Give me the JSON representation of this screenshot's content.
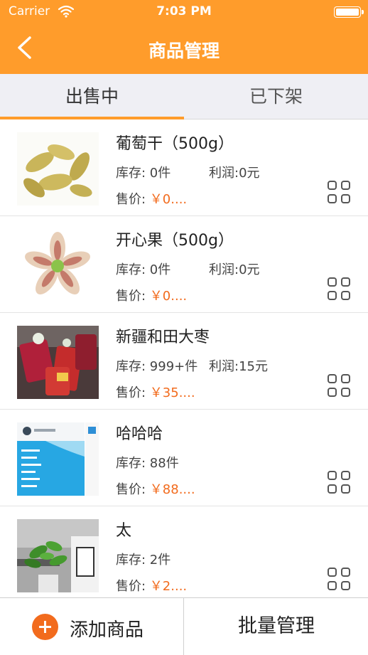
{
  "status_bar": {
    "carrier": "Carrier",
    "time": "7:03 PM"
  },
  "nav": {
    "title": "商品管理",
    "back_icon": "chevron-left-icon"
  },
  "tabs": [
    {
      "label": "出售中",
      "active": true
    },
    {
      "label": "已下架",
      "active": false
    }
  ],
  "products": [
    {
      "name": "葡萄干（500g）",
      "stock": "库存: 0件",
      "profit": "利润:0元",
      "price_label": "售价: ",
      "price_value": "￥0...."
    },
    {
      "name": "开心果（500g）",
      "stock": "库存: 0件",
      "profit": "利润:0元",
      "price_label": "售价: ",
      "price_value": "￥0...."
    },
    {
      "name": "新疆和田大枣",
      "stock": "库存: 999+件",
      "profit": "利润:15元",
      "price_label": "售价: ",
      "price_value": "￥35...."
    },
    {
      "name": "哈哈哈",
      "stock": "库存: 88件",
      "profit": "",
      "price_label": "售价: ",
      "price_value": "￥88...."
    },
    {
      "name": "太",
      "stock": "库存: 2件",
      "profit": "",
      "price_label": "售价: ",
      "price_value": "￥2...."
    }
  ],
  "bottom_bar": {
    "add_label": "添加商品",
    "batch_label": "批量管理"
  },
  "colors": {
    "brand": "#FF9C2B",
    "price": "#F26B1D",
    "tab_bg": "#EFEFF4"
  }
}
